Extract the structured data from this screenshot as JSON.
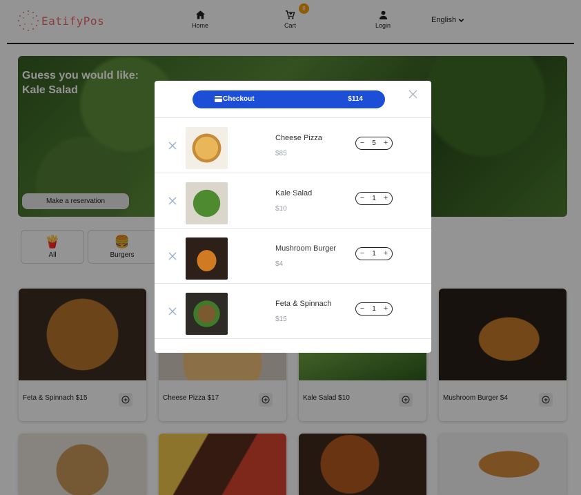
{
  "header": {
    "logo_text": "EatifyPos",
    "nav": {
      "home": "Home",
      "cart": "Cart",
      "cart_count": "8",
      "login": "Login"
    },
    "language": "English"
  },
  "hero": {
    "title_line1": "Guess you would like:",
    "title_line2": "Kale Salad",
    "reservation_button": "Make a reservation"
  },
  "categories": [
    {
      "label": "All",
      "icon": "fries-icon"
    },
    {
      "label": "Burgers",
      "icon": "burger-icon"
    }
  ],
  "products": [
    {
      "label": "Feta & Spinnach $15"
    },
    {
      "label": "Cheese Pizza $17"
    },
    {
      "label": "Kale Salad $10"
    },
    {
      "label": "Mushroom Burger $4"
    },
    {
      "label": ""
    },
    {
      "label": ""
    },
    {
      "label": ""
    },
    {
      "label": ""
    }
  ],
  "cart_modal": {
    "checkout_label": "Checkout",
    "total": "$114",
    "items": [
      {
        "name": "Cheese Pizza",
        "price": "$85",
        "qty": "5"
      },
      {
        "name": "Kale Salad",
        "price": "$10",
        "qty": "1"
      },
      {
        "name": "Mushroom Burger",
        "price": "$4",
        "qty": "1"
      },
      {
        "name": "Feta & Spinnach",
        "price": "$15",
        "qty": "1"
      }
    ]
  },
  "colors": {
    "accent": "#1d4ed8",
    "logo": "#e8696b",
    "badge": "#f59e0b"
  }
}
